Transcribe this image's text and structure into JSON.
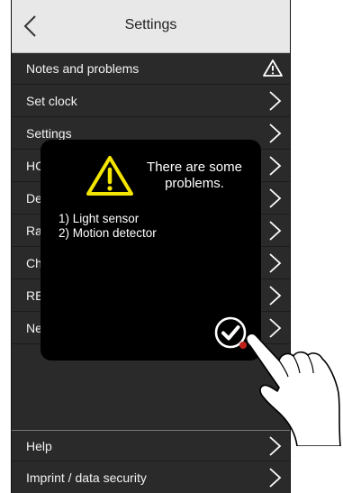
{
  "header": {
    "title": "Settings",
    "back_icon": "chevron-left-icon"
  },
  "menu": [
    {
      "label": "Notes and problems",
      "icon": "warning-icon"
    },
    {
      "label": "Set clock",
      "icon": "chevron-right-icon"
    },
    {
      "label": "Settings",
      "icon": "chevron-right-icon"
    },
    {
      "label": "HC",
      "icon": "chevron-right-icon"
    },
    {
      "label": "De",
      "icon": "chevron-right-icon"
    },
    {
      "label": "Ra",
      "icon": "chevron-right-icon"
    },
    {
      "label": "Ch",
      "icon": "chevron-right-icon"
    },
    {
      "label": "RE",
      "icon": "chevron-right-icon"
    },
    {
      "label": "Ne",
      "icon": "chevron-right-icon"
    }
  ],
  "footer_menu": [
    {
      "label": "Help",
      "icon": "chevron-right-icon"
    },
    {
      "label": "Imprint / data security",
      "icon": "chevron-right-icon"
    }
  ],
  "dialog": {
    "title": "There are some problems.",
    "problems": [
      "1) Light sensor",
      "2) Motion detector"
    ],
    "confirm_icon": "checkmark-icon",
    "warning_icon": "warning-icon",
    "warning_color": "#f4e500"
  },
  "colors": {
    "background": "#2a2a2a",
    "header": "#e8e8e8",
    "dialog": "#000000",
    "tap_indicator": "#c0201a"
  }
}
